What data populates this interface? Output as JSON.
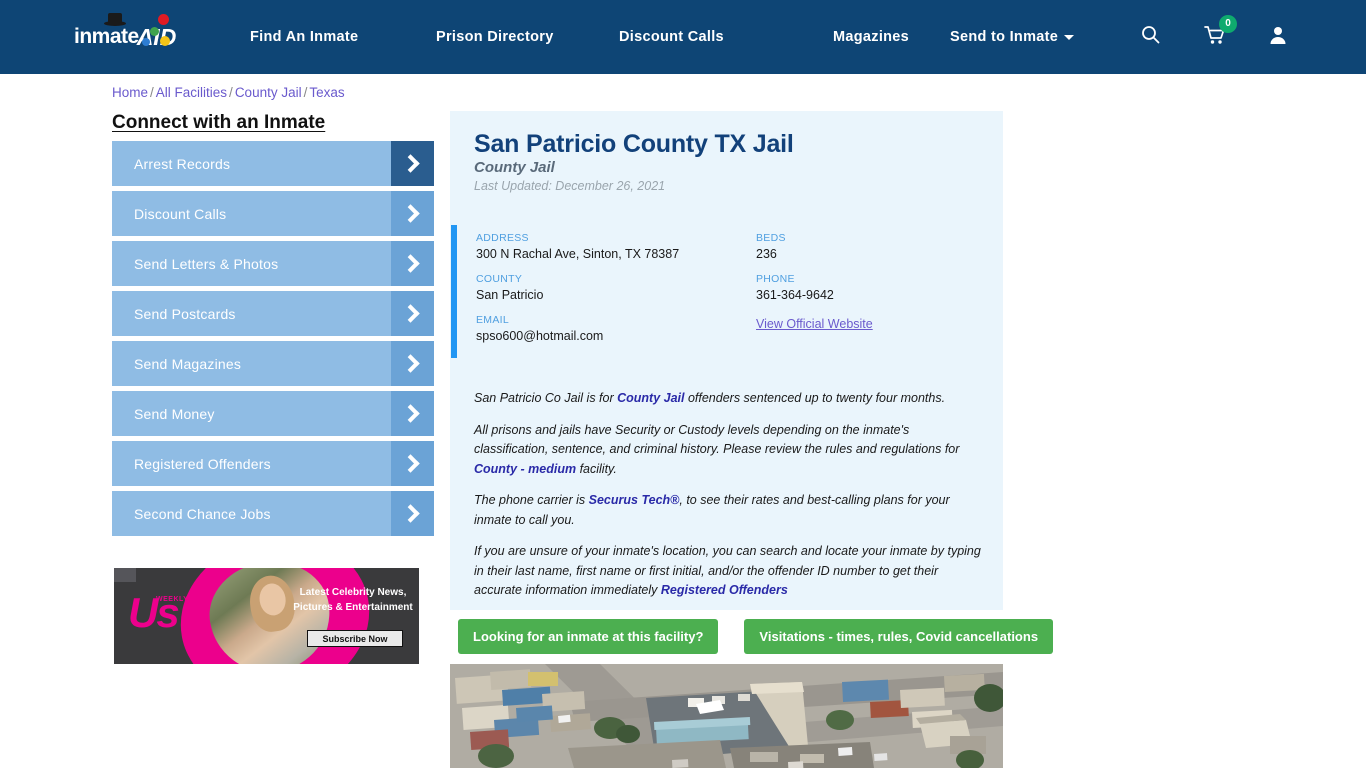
{
  "header": {
    "logo": {
      "text_primary": "inmate",
      "text_secondary": "AID",
      "icon": "inmate-aid-logo"
    },
    "nav": [
      {
        "label": "Find An Inmate",
        "icon": ""
      },
      {
        "label": "Prison Directory",
        "icon": ""
      },
      {
        "label": "Discount Calls",
        "icon": ""
      },
      {
        "label": "Magazines",
        "icon": ""
      },
      {
        "label": "Send to Inmate",
        "icon": "chevron-down-icon",
        "has_caret": true
      }
    ],
    "icons": {
      "search": "search-icon",
      "cart": "cart-icon",
      "cart_count": "0",
      "account": "user-icon"
    },
    "colors": {
      "background": "#0e4575",
      "badge": "#0faa6e"
    }
  },
  "breadcrumb": {
    "separator": "/",
    "items": [
      {
        "label": "Home"
      },
      {
        "label": "All Facilities"
      },
      {
        "label": "County Jail"
      },
      {
        "label": "Texas"
      }
    ]
  },
  "sidebar": {
    "title": "Connect with an Inmate",
    "items": [
      {
        "label": "Arrest Records",
        "active": true
      },
      {
        "label": "Discount Calls",
        "active": false
      },
      {
        "label": "Send Letters & Photos",
        "active": false
      },
      {
        "label": "Send Postcards",
        "active": false
      },
      {
        "label": "Send Magazines",
        "active": false
      },
      {
        "label": "Send Money",
        "active": false
      },
      {
        "label": "Registered Offenders",
        "active": false
      },
      {
        "label": "Second Chance Jobs",
        "active": false
      }
    ]
  },
  "ad": {
    "brand": "Us",
    "brand_sub": "WEEKLY",
    "headline": "Latest Celebrity News, Pictures & Entertainment",
    "cta": "Subscribe Now"
  },
  "facility": {
    "name": "San Patricio County TX Jail",
    "type": "County Jail",
    "last_updated": "Last Updated: December 26, 2021",
    "info": [
      {
        "label": "ADDRESS",
        "value": "300 N Rachal Ave, Sinton, TX 78387",
        "link": false
      },
      {
        "label": "BEDS",
        "value": "236",
        "link": false
      },
      {
        "label": "COUNTY",
        "value": "San Patricio",
        "link": false
      },
      {
        "label": "PHONE",
        "value": "361-364-9642",
        "link": false
      },
      {
        "label": "EMAIL",
        "value": "spso600@hotmail.com",
        "link": false
      },
      {
        "label": "",
        "value": "View Official Website",
        "link": true
      }
    ],
    "paragraphs": [
      {
        "parts": [
          {
            "t": "San Patricio Co Jail is for ",
            "bold": false
          },
          {
            "t": "County Jail",
            "bold": true
          },
          {
            "t": " offenders sentenced up to twenty four months.",
            "bold": false
          }
        ]
      },
      {
        "parts": [
          {
            "t": "All prisons and jails have Security or Custody levels depending on the inmate's classification, sentence, and criminal history. Please review the rules and regulations for ",
            "bold": false
          },
          {
            "t": "County - medium",
            "bold": true
          },
          {
            "t": " facility.",
            "bold": false
          }
        ]
      },
      {
        "parts": [
          {
            "t": "The phone carrier is ",
            "bold": false
          },
          {
            "t": "Securus Tech®",
            "bold": true
          },
          {
            "t": ", to see their rates and best-calling plans for your inmate to call you.",
            "bold": false
          }
        ]
      },
      {
        "parts": [
          {
            "t": "If you are unsure of your inmate's location, you can search and locate your inmate by typing in their last name, first name or first initial, and/or the offender ID number to get their accurate information immediately ",
            "bold": false
          },
          {
            "t": "Registered Offenders",
            "bold": true
          }
        ]
      }
    ]
  },
  "actions": {
    "buttons": [
      {
        "label": "Looking for an inmate at this facility?"
      },
      {
        "label": "Visitations - times, rules, Covid cancellations"
      }
    ],
    "color": "#4caf50"
  },
  "photo": {
    "alt": "aerial-view-of-facility"
  },
  "colors": {
    "header_bg": "#0e4575",
    "panel_bg": "#eaf5fc",
    "accent_blue": "#2196f3",
    "sidebar_btn": "#8fbce4",
    "sidebar_btn_arrow": "#6ba3d6",
    "sidebar_btn_arrow_active": "#2a5d8f",
    "link": "#6a5acd",
    "strong_link": "#2a2aa8",
    "green": "#4caf50"
  }
}
